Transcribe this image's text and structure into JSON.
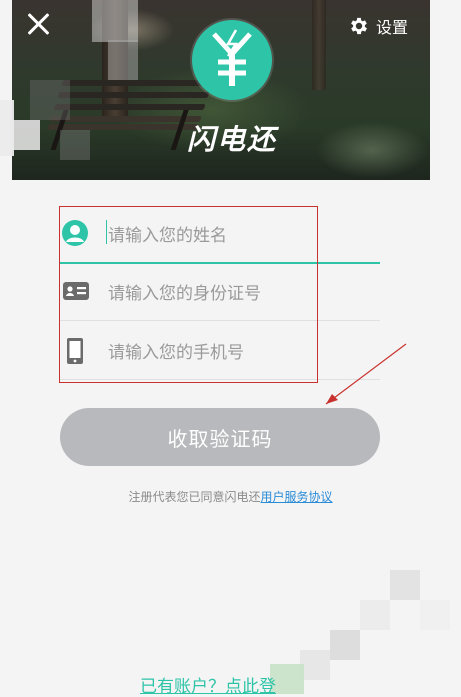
{
  "header": {
    "app_name": "闪电还",
    "settings_label": "设置",
    "logo_symbol": "¥",
    "accent_color": "#2ec4a8"
  },
  "form": {
    "fields": [
      {
        "icon": "person-icon",
        "placeholder": "请输入您的姓名"
      },
      {
        "icon": "id-card-icon",
        "placeholder": "请输入您的身份证号"
      },
      {
        "icon": "phone-icon",
        "placeholder": "请输入您的手机号"
      }
    ],
    "submit_label": "收取验证码",
    "submit_color": "#b7b9bc"
  },
  "agreement": {
    "prefix": "注册代表您已同意闪电还",
    "link_label": "用户服务协议",
    "link_color": "#2a8bd6"
  },
  "footer": {
    "login_link": "已有账户？点此登"
  }
}
